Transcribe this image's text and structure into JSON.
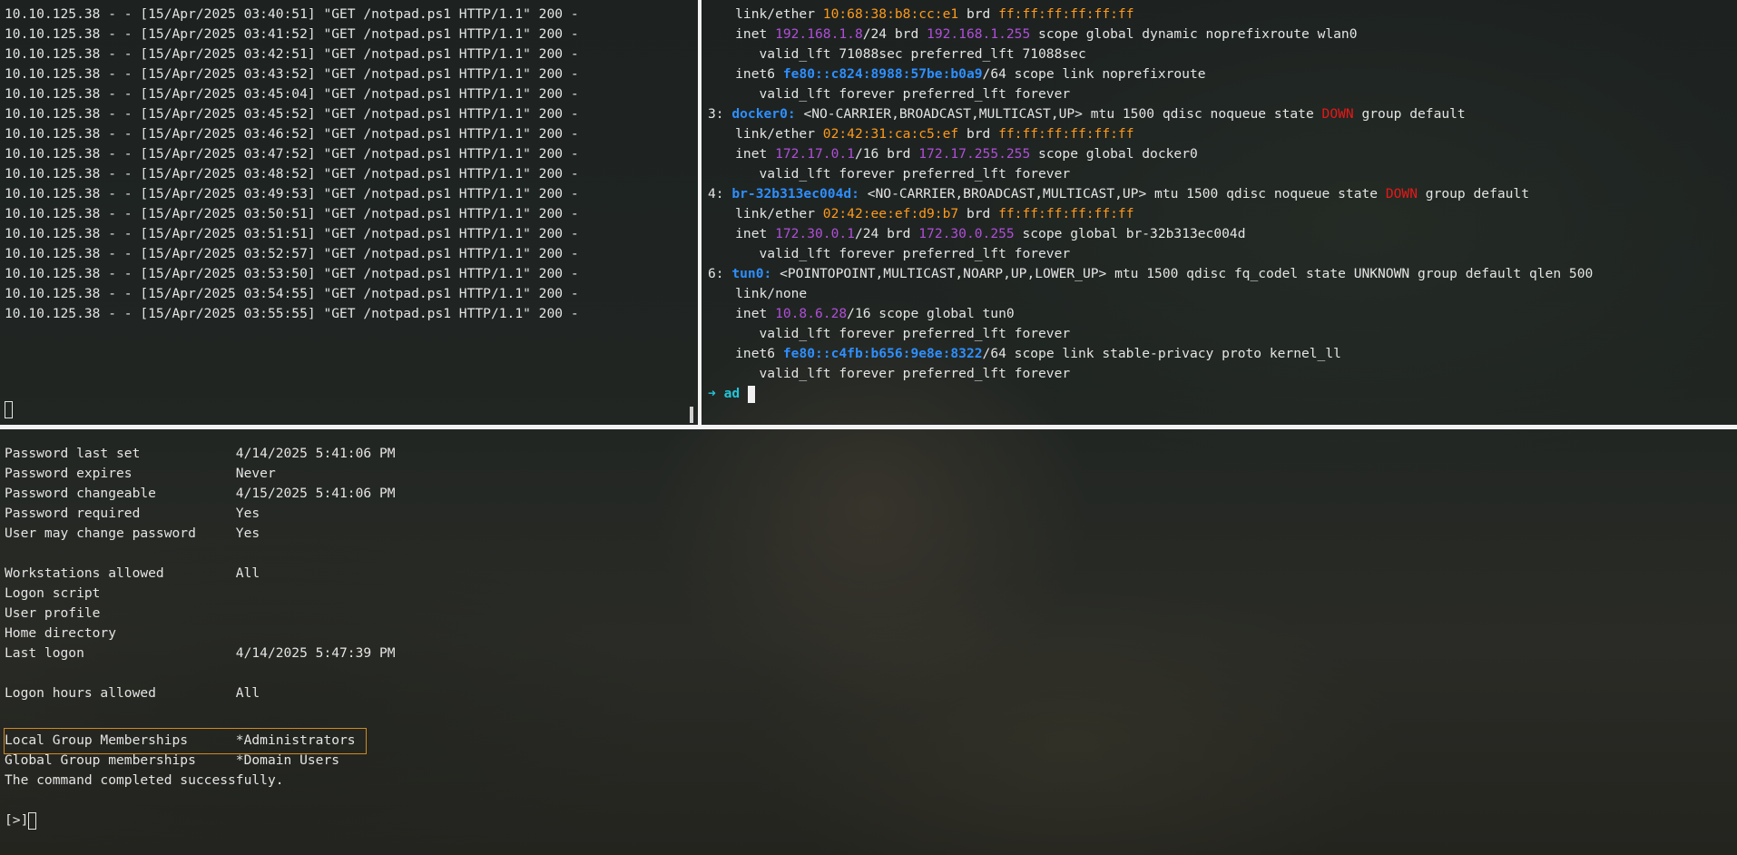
{
  "colors": {
    "interface": "#2e8fff",
    "mac": "#ff9a1a",
    "ip": "#b14ed9",
    "down": "#e81818",
    "prompt": "#23c4d9",
    "highlight": "#d18a1c"
  },
  "top_left": {
    "log_lines": [
      "10.10.125.38 - - [15/Apr/2025 03:40:51] \"GET /notpad.ps1 HTTP/1.1\" 200 -",
      "10.10.125.38 - - [15/Apr/2025 03:41:52] \"GET /notpad.ps1 HTTP/1.1\" 200 -",
      "10.10.125.38 - - [15/Apr/2025 03:42:51] \"GET /notpad.ps1 HTTP/1.1\" 200 -",
      "10.10.125.38 - - [15/Apr/2025 03:43:52] \"GET /notpad.ps1 HTTP/1.1\" 200 -",
      "10.10.125.38 - - [15/Apr/2025 03:45:04] \"GET /notpad.ps1 HTTP/1.1\" 200 -",
      "10.10.125.38 - - [15/Apr/2025 03:45:52] \"GET /notpad.ps1 HTTP/1.1\" 200 -",
      "10.10.125.38 - - [15/Apr/2025 03:46:52] \"GET /notpad.ps1 HTTP/1.1\" 200 -",
      "10.10.125.38 - - [15/Apr/2025 03:47:52] \"GET /notpad.ps1 HTTP/1.1\" 200 -",
      "10.10.125.38 - - [15/Apr/2025 03:48:52] \"GET /notpad.ps1 HTTP/1.1\" 200 -",
      "10.10.125.38 - - [15/Apr/2025 03:49:53] \"GET /notpad.ps1 HTTP/1.1\" 200 -",
      "10.10.125.38 - - [15/Apr/2025 03:50:51] \"GET /notpad.ps1 HTTP/1.1\" 200 -",
      "10.10.125.38 - - [15/Apr/2025 03:51:51] \"GET /notpad.ps1 HTTP/1.1\" 200 -",
      "10.10.125.38 - - [15/Apr/2025 03:52:57] \"GET /notpad.ps1 HTTP/1.1\" 200 -",
      "10.10.125.38 - - [15/Apr/2025 03:53:50] \"GET /notpad.ps1 HTTP/1.1\" 200 -",
      "10.10.125.38 - - [15/Apr/2025 03:54:55] \"GET /notpad.ps1 HTTP/1.1\" 200 -",
      "10.10.125.38 - - [15/Apr/2025 03:55:55] \"GET /notpad.ps1 HTTP/1.1\" 200 -"
    ]
  },
  "top_right": {
    "l01": {
      "pre": "    link/ether ",
      "mac": "10:68:38:b8:cc:e1",
      "mid": " brd ",
      "brd": "ff:ff:ff:ff:ff:ff"
    },
    "l02": {
      "pre": "    inet ",
      "ip": "192.168.1.8",
      "mid": "/24 brd ",
      "brd": "192.168.1.255",
      "post": " scope global dynamic noprefixroute wlan0"
    },
    "l03": "       valid_lft 71088sec preferred_lft 71088sec",
    "l04": {
      "pre": "    inet6 ",
      "ip": "fe80::c824:8988:57be:b0a9",
      "post": "/64 scope link noprefixroute"
    },
    "l05": "       valid_lft forever preferred_lft forever",
    "l06": {
      "num": "3: ",
      "iface": "docker0:",
      "mid": " <NO-CARRIER,BROADCAST,MULTICAST,UP> mtu 1500 qdisc noqueue state ",
      "state": "DOWN",
      "post": " group default"
    },
    "l07": {
      "pre": "    link/ether ",
      "mac": "02:42:31:ca:c5:ef",
      "mid": " brd ",
      "brd": "ff:ff:ff:ff:ff:ff"
    },
    "l08": {
      "pre": "    inet ",
      "ip": "172.17.0.1",
      "mid": "/16 brd ",
      "brd": "172.17.255.255",
      "post": " scope global docker0"
    },
    "l09": "       valid_lft forever preferred_lft forever",
    "l10": {
      "num": "4: ",
      "iface": "br-32b313ec004d:",
      "mid": " <NO-CARRIER,BROADCAST,MULTICAST,UP> mtu 1500 qdisc noqueue state ",
      "state": "DOWN",
      "post": " group default"
    },
    "l11": {
      "pre": "    link/ether ",
      "mac": "02:42:ee:ef:d9:b7",
      "mid": " brd ",
      "brd": "ff:ff:ff:ff:ff:ff"
    },
    "l12": {
      "pre": "    inet ",
      "ip": "172.30.0.1",
      "mid": "/24 brd ",
      "brd": "172.30.0.255",
      "post": " scope global br-32b313ec004d"
    },
    "l13": "       valid_lft forever preferred_lft forever",
    "l14": {
      "num": "6: ",
      "iface": "tun0:",
      "post": " <POINTOPOINT,MULTICAST,NOARP,UP,LOWER_UP> mtu 1500 qdisc fq_codel state UNKNOWN group default qlen 500"
    },
    "l15": "    link/none",
    "l16": {
      "pre": "    inet ",
      "ip": "10.8.6.28",
      "post": "/16 scope global tun0"
    },
    "l17": "       valid_lft forever preferred_lft forever",
    "l18": {
      "pre": "    inet6 ",
      "ip": "fe80::c4fb:b656:9e8e:8322",
      "post": "/64 scope link stable-privacy proto kernel_ll"
    },
    "l19": "       valid_lft forever preferred_lft forever",
    "prompt": {
      "arrow": "➜",
      "text": "ad"
    }
  },
  "bottom": {
    "lines": [
      "Password last set            4/14/2025 5:41:06 PM",
      "Password expires             Never",
      "Password changeable          4/15/2025 5:41:06 PM",
      "Password required            Yes",
      "User may change password     Yes",
      "",
      "Workstations allowed         All",
      "Logon script",
      "User profile",
      "Home directory",
      "Last logon                   4/14/2025 5:47:39 PM",
      "",
      "Logon hours allowed          All",
      "",
      "Local Group Memberships      *Administrators",
      "Global Group memberships     *Domain Users",
      "The command completed successfully.",
      ""
    ],
    "prompt": "[>]"
  }
}
